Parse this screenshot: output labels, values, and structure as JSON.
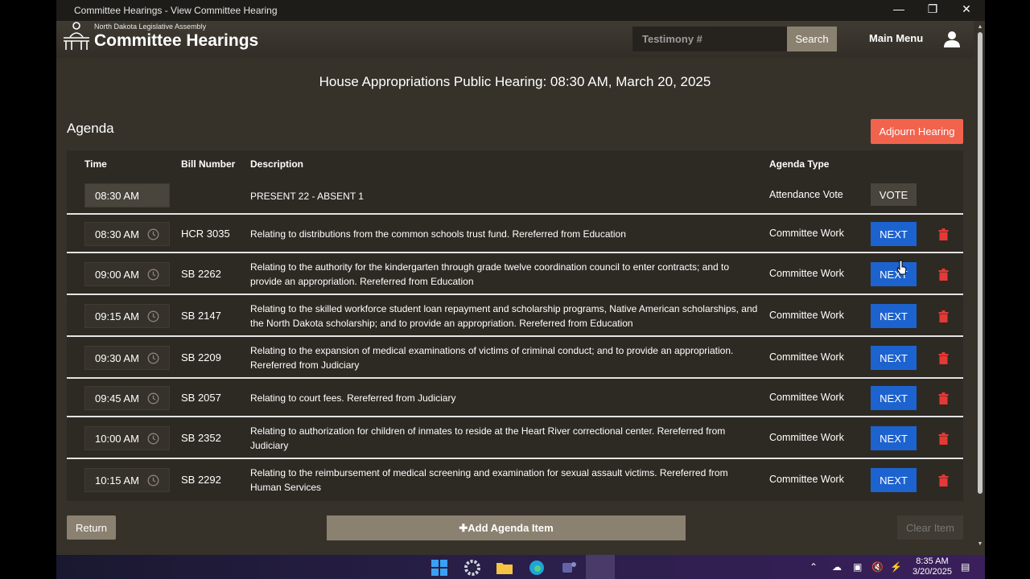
{
  "window": {
    "title": "Committee Hearings - View Committee Hearing"
  },
  "header": {
    "org": "North Dakota Legislative Assembly",
    "app_title": "Committee Hearings",
    "search_placeholder": "Testimony #",
    "search_label": "Search",
    "main_menu": "Main Menu"
  },
  "hearing": {
    "title": "House Appropriations Public Hearing: 08:30 AM, March 20, 2025"
  },
  "agenda": {
    "label": "Agenda",
    "adjourn_label": "Adjourn Hearing",
    "columns": {
      "time": "Time",
      "bill": "Bill Number",
      "desc": "Description",
      "type": "Agenda Type"
    },
    "attendance": {
      "time": "08:30 AM",
      "desc": "PRESENT 22 - ABSENT 1",
      "type": "Attendance Vote",
      "action": "VOTE"
    },
    "rows": [
      {
        "time": "08:30 AM",
        "bill": "HCR 3035",
        "desc": "Relating to distributions from the common schools trust fund. Rereferred from Education",
        "type": "Committee Work",
        "action": "NEXT"
      },
      {
        "time": "09:00 AM",
        "bill": "SB 2262",
        "desc": "Relating to the authority for the kindergarten through grade twelve coordination council to enter contracts; and to provide an appropriation. Rereferred from Education",
        "type": "Committee Work",
        "action": "NEXT"
      },
      {
        "time": "09:15 AM",
        "bill": "SB 2147",
        "desc": "Relating to the skilled workforce student loan repayment and scholarship programs, Native American scholarships, and the North Dakota scholarship; and to provide an appropriation. Rereferred from Education",
        "type": "Committee Work",
        "action": "NEXT"
      },
      {
        "time": "09:30 AM",
        "bill": "SB 2209",
        "desc": "Relating to the expansion of medical examinations of victims of criminal conduct; and to provide an appropriation. Rereferred from Judiciary",
        "type": "Committee Work",
        "action": "NEXT"
      },
      {
        "time": "09:45 AM",
        "bill": "SB 2057",
        "desc": "Relating to court fees. Rereferred from Judiciary",
        "type": "Committee Work",
        "action": "NEXT"
      },
      {
        "time": "10:00 AM",
        "bill": "SB 2352",
        "desc": "Relating to authorization for children of inmates to reside at the Heart River correctional center. Rereferred from Judiciary",
        "type": "Committee Work",
        "action": "NEXT"
      },
      {
        "time": "10:15 AM",
        "bill": "SB 2292",
        "desc": "Relating to the reimbursement of medical screening and examination for sexual assault victims. Rereferred from Human Services",
        "type": "Committee Work",
        "action": "NEXT"
      }
    ]
  },
  "footer": {
    "return_label": "Return",
    "add_label": "Add Agenda Item",
    "clear_label": "Clear Item"
  },
  "taskbar": {
    "time": "8:35 AM",
    "date": "3/20/2025"
  },
  "colors": {
    "next": "#1d63d0",
    "adjourn": "#f2634e",
    "trash": "#e53935",
    "button_tan": "#8b8170"
  }
}
